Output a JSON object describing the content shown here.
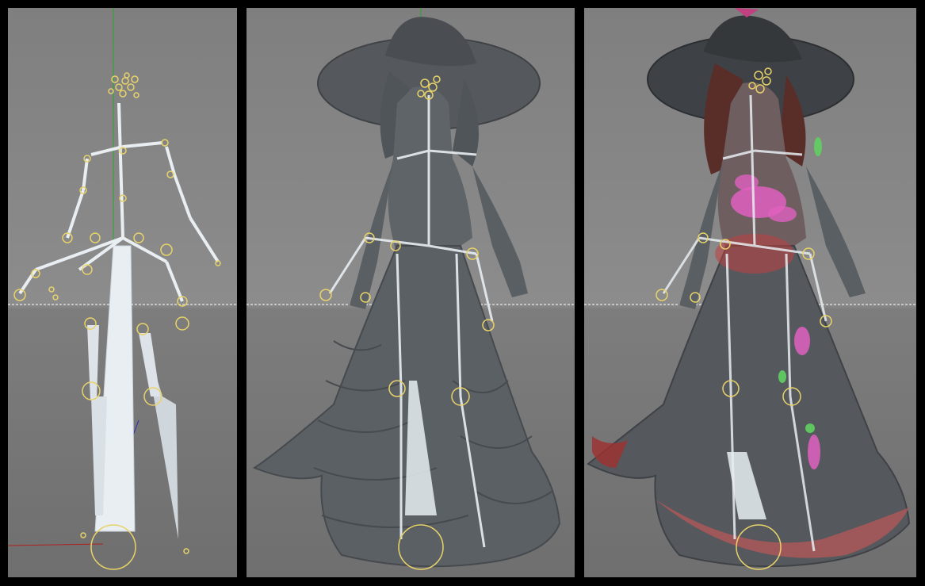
{
  "layout_name": "rig-comparison",
  "viewports": [
    {
      "name": "skeleton-only",
      "label": ""
    },
    {
      "name": "skeleton-with-mesh",
      "label": ""
    },
    {
      "name": "skeleton-with-weight-paint",
      "label": ""
    }
  ],
  "colors": {
    "background": "#808080",
    "joint_yellow": "#e8d36a",
    "bone_white": "#e8eef2",
    "mesh_gray": "#5f6468",
    "weight_pink": "#e060c0",
    "weight_red": "#c04040",
    "weight_green": "#60d060",
    "axis_green": "#2aa52a",
    "axis_red": "#b02020",
    "grid_dash": "#d8d8d8"
  }
}
